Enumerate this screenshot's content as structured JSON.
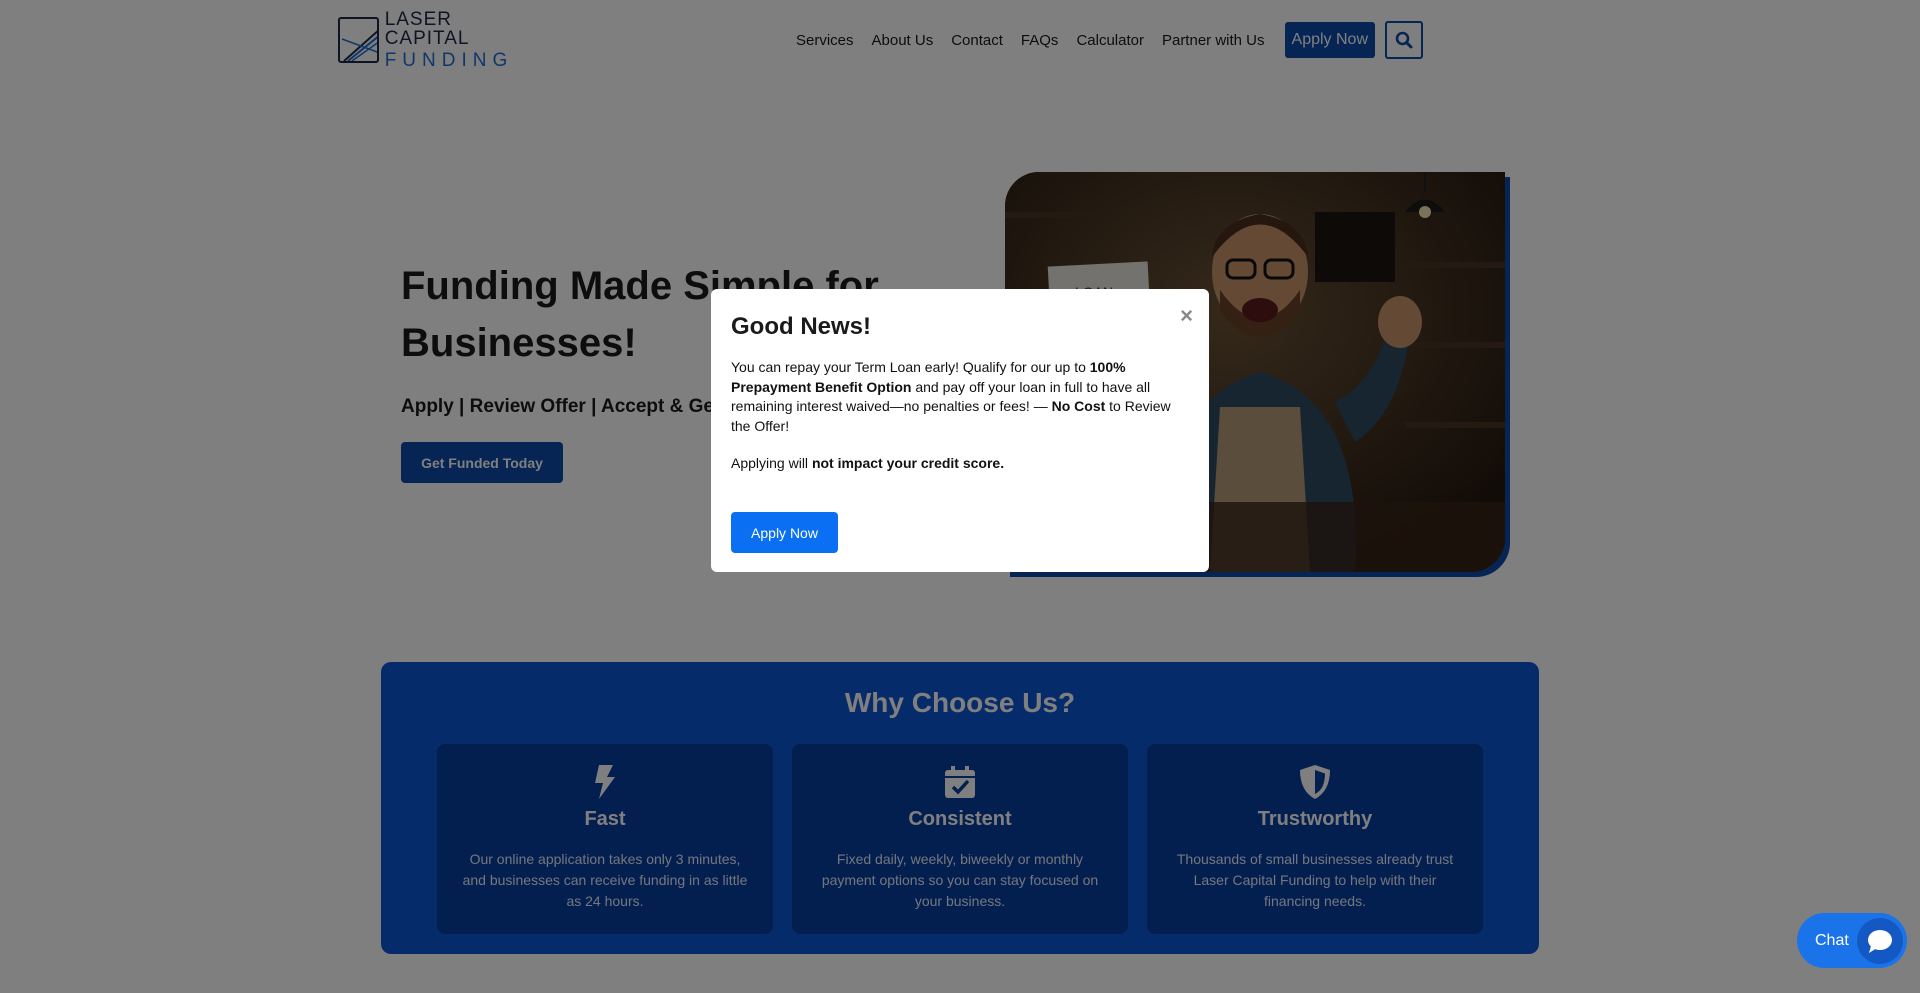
{
  "header": {
    "logo_line1": "LASER CAPITAL",
    "logo_line2": "FUNDING",
    "nav": [
      "Services",
      "About Us",
      "Contact",
      "FAQs",
      "Calculator",
      "Partner with Us"
    ],
    "apply_label": "Apply Now",
    "search_icon": "search-icon"
  },
  "hero": {
    "title": "Funding Made Simple for Businesses!",
    "subtitle": "Apply | Review Offer | Accept & Get Funded",
    "button": "Get Funded Today",
    "sign_text": "LOAN"
  },
  "why": {
    "title": "Why Choose Us?",
    "cards": [
      {
        "icon": "lightning-bolt-icon",
        "title": "Fast",
        "text": "Our online application takes only 3 minutes, and businesses can receive funding in as little as 24 hours."
      },
      {
        "icon": "calendar-check-icon",
        "title": "Consistent",
        "text": "Fixed daily, weekly, biweekly or monthly payment options so you can stay focused on your business."
      },
      {
        "icon": "shield-icon",
        "title": "Trustworthy",
        "text": "Thousands of small businesses already trust Laser Capital Funding to help with their financing needs."
      }
    ]
  },
  "modal": {
    "close": "×",
    "title": "Good News!",
    "p1_a": "You can repay your Term Loan early! Qualify for our up to ",
    "p1_b": "100% Prepayment Benefit Option",
    "p1_c": " and pay off your loan in full to have all remaining interest waived—no penalties or fees! — ",
    "p1_d": "No Cost",
    "p1_e": " to Review the Offer!",
    "p2_a": "Applying will ",
    "p2_b": "not impact your credit score.",
    "button": "Apply Now"
  },
  "chat": {
    "label": "Chat",
    "icon": "chat-bubble-icon"
  },
  "colors": {
    "brand_blue": "#0d4aa8",
    "section_blue": "#0d57d6",
    "modal_button": "#0a6ff2"
  }
}
